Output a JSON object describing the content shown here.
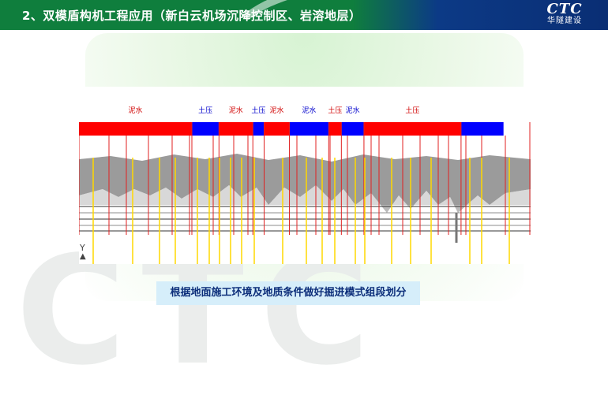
{
  "header": {
    "title": "2、双模盾构机工程应用（新白云机场沉降控制区、岩溶地层）",
    "logo_mark": "CTC",
    "logo_text": "华隧建设"
  },
  "figure": {
    "top_labels": [
      "泥水",
      "土压",
      "泥水",
      "土压",
      "泥水",
      "泥水",
      "土压",
      "泥水",
      "土压"
    ],
    "mode_bar": [
      {
        "mode": "泥水",
        "color": "#ff0000",
        "fraction": 0.25
      },
      {
        "mode": "土压",
        "color": "#0000ff",
        "fraction": 0.06
      },
      {
        "mode": "泥水",
        "color": "#ff0000",
        "fraction": 0.075
      },
      {
        "mode": "土压",
        "color": "#0000ff",
        "fraction": 0.025
      },
      {
        "mode": "泥水",
        "color": "#ff0000",
        "fraction": 0.056
      },
      {
        "mode": "土压",
        "color": "#0000ff",
        "fraction": 0.087
      },
      {
        "mode": "泥水",
        "color": "#ff0000",
        "fraction": 0.028
      },
      {
        "mode": "土压",
        "color": "#0000ff",
        "fraction": 0.05
      },
      {
        "mode": "泥水",
        "color": "#ff0000",
        "fraction": 0.215
      },
      {
        "mode": "土压",
        "color": "#0000ff",
        "fraction": 0.094
      }
    ],
    "y_axis_label": "Y"
  },
  "caption": "根据地面施工环境及地质条件做好掘进模式组段划分",
  "colors": {
    "green": "#0f7e3d",
    "navy": "#0c3a86",
    "slurry": "#ff0000",
    "epb": "#0000ff",
    "caption_bg": "#d6eefa"
  }
}
